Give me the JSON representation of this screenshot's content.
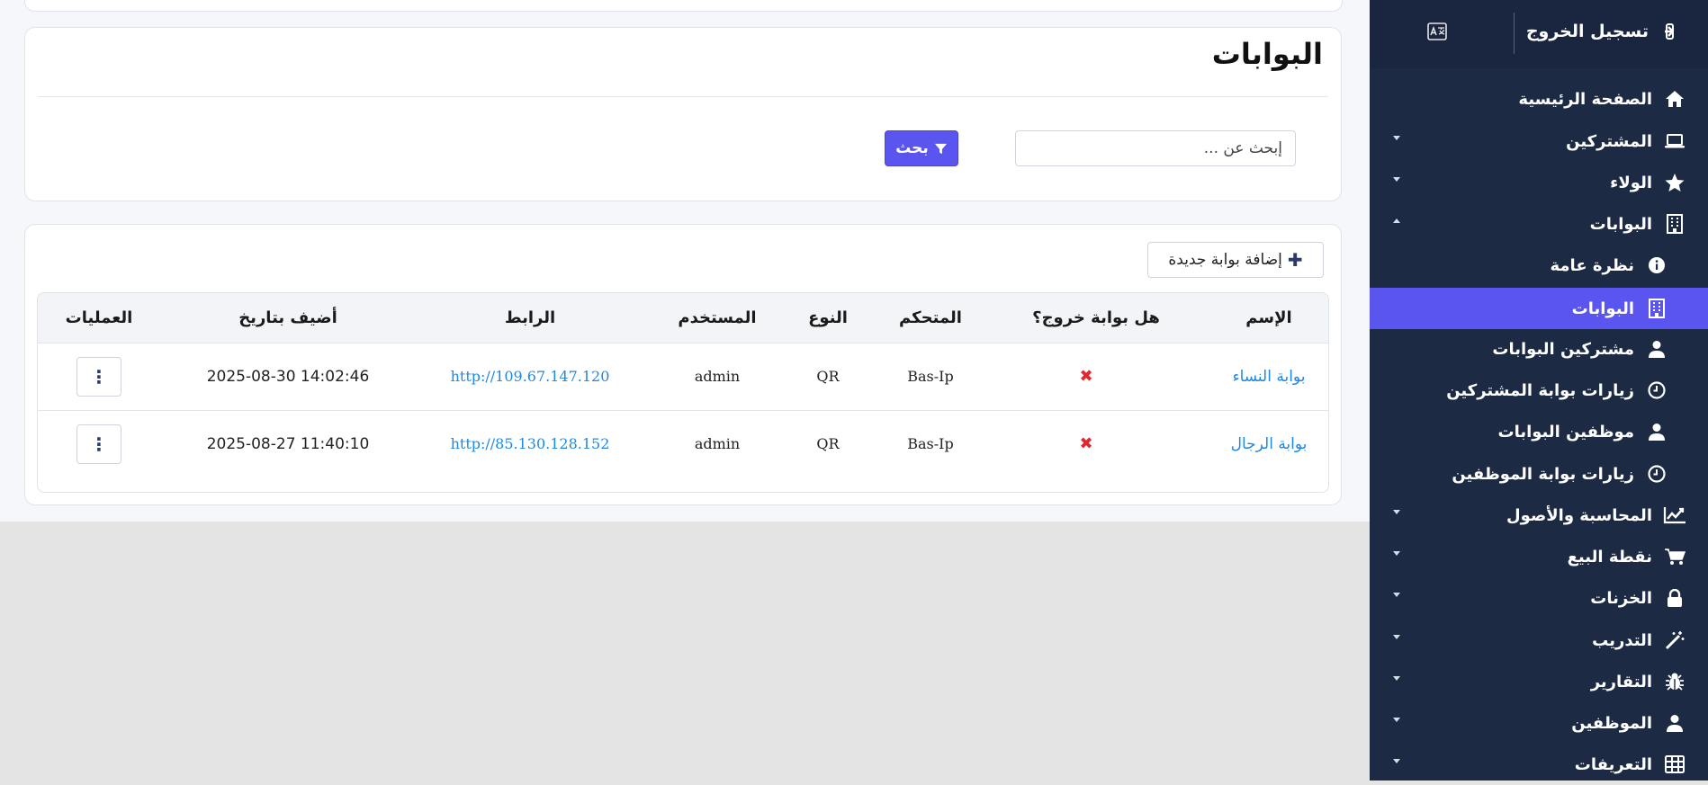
{
  "main": {
    "page_title": "البوابات",
    "search": {
      "placeholder": "إبحث عن ...",
      "value": "",
      "button_label": "بحث"
    },
    "add_button_label": "إضافة بوابة جديدة",
    "table": {
      "columns": {
        "name": "الإسم",
        "exit_gate": "هل بوابة خروج؟",
        "controller": "المتحكم",
        "type": "النوع",
        "user": "المستخدم",
        "link": "الرابط",
        "added_at": "أضيف بتاريخ",
        "actions": "العمليات"
      },
      "rows": [
        {
          "name": "بوابة النساء",
          "exit_gate": "✖",
          "controller": "Bas-Ip",
          "type": "QR",
          "user": "admin",
          "link": "http://109.67.147.120",
          "added_at": "2025-08-30 14:02:46",
          "actions": "⋮"
        },
        {
          "name": "بوابة الرجال",
          "exit_gate": "✖",
          "controller": "Bas-Ip",
          "type": "QR",
          "user": "admin",
          "link": "http://85.130.128.152",
          "added_at": "2025-08-27 11:40:10",
          "actions": "⋮"
        }
      ]
    }
  },
  "sidebar": {
    "logout_label": "تسجيل الخروج",
    "items": [
      {
        "label": "الصفحة الرئيسية",
        "icon": "home-icon"
      },
      {
        "label": "المشتركين",
        "icon": "laptop-icon"
      },
      {
        "label": "الولاء",
        "icon": "star-icon"
      },
      {
        "label": "البوابات",
        "icon": "building-icon"
      },
      {
        "label": "نظرة عامة",
        "icon": "info-icon"
      },
      {
        "label": "البوابات",
        "icon": "building-icon"
      },
      {
        "label": "مشتركين البوابات",
        "icon": "user-icon"
      },
      {
        "label": "زيارات بوابة المشتركين",
        "icon": "clock-icon"
      },
      {
        "label": "موظفين البوابات",
        "icon": "user-icon"
      },
      {
        "label": "زيارات بوابة الموظفين",
        "icon": "clock-icon"
      },
      {
        "label": "المحاسبة والأصول",
        "icon": "chart-line-icon"
      },
      {
        "label": "نقطة البيع",
        "icon": "cart-icon"
      },
      {
        "label": "الخزنات",
        "icon": "lock-icon"
      },
      {
        "label": "التدريب",
        "icon": "magic-wand-icon"
      },
      {
        "label": "التقارير",
        "icon": "bug-icon"
      },
      {
        "label": "الموظفين",
        "icon": "user-icon"
      },
      {
        "label": "التعريفات",
        "icon": "table-icon"
      }
    ]
  },
  "colors": {
    "accent": "#5a55ee",
    "sidebar_bg": "#1d2a44",
    "link": "#1e88e5",
    "danger": "#e0262f"
  }
}
